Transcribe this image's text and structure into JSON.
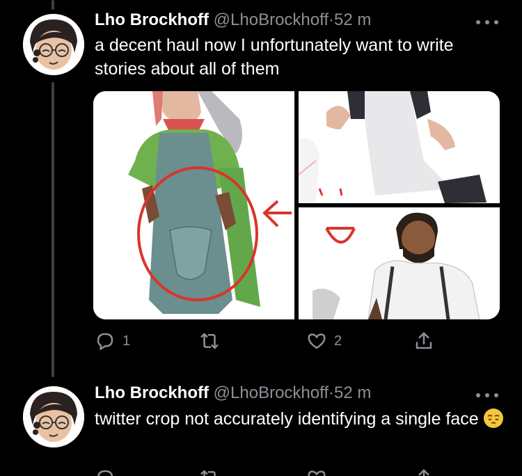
{
  "tweets": [
    {
      "author_name": "Lho Brockhoff",
      "handle": "@LhoBrockhoff",
      "separator": "·",
      "time": "52 m",
      "text": "a decent haul now I unfortunately want to write stories about all of them",
      "reply_count": "1",
      "retweet_count": "",
      "like_count": "2"
    },
    {
      "author_name": "Lho Brockhoff",
      "handle": "@LhoBrockhoff",
      "separator": "·",
      "time": "52 m",
      "text": "twitter crop not accurately identifying a single face",
      "emoji": "pensive-face"
    }
  ],
  "icons": {
    "more": "more-horizontal-icon",
    "reply": "reply-bubble-icon",
    "retweet": "retweet-icon",
    "like": "heart-icon",
    "share": "share-icon"
  },
  "colors": {
    "background": "#000000",
    "text_primary": "#ffffff",
    "text_secondary": "#8b9096",
    "thread_line": "#3d4046",
    "annotation_red": "#d9342b"
  }
}
